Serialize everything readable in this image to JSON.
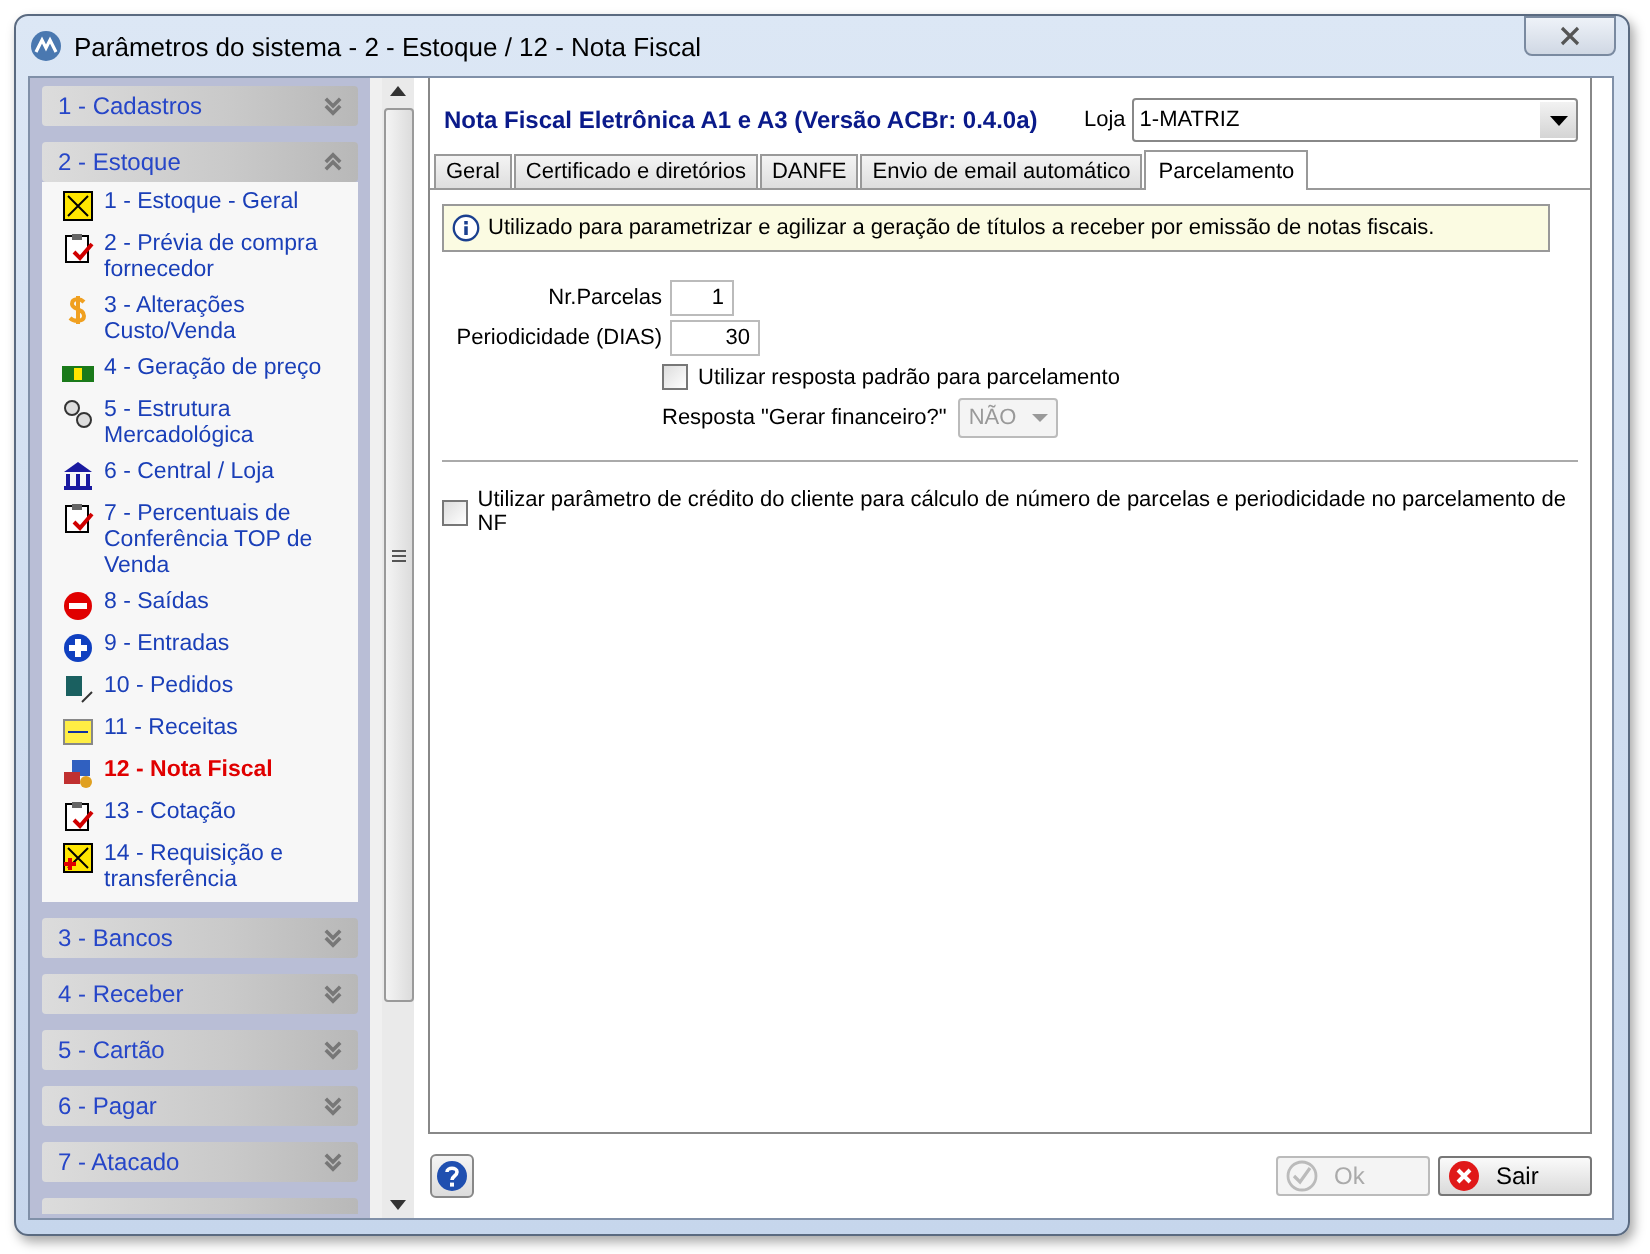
{
  "window": {
    "title": "Parâmetros do sistema - 2 - Estoque / 12 - Nota Fiscal"
  },
  "sidebar": {
    "groups": [
      {
        "label": "1 - Cadastros",
        "expanded": false
      },
      {
        "label": "2 - Estoque",
        "expanded": true,
        "items": [
          {
            "label": "1 - Estoque - Geral",
            "selected": false
          },
          {
            "label": "2 - Prévia de compra fornecedor",
            "selected": false
          },
          {
            "label": "3 - Alterações Custo/Venda",
            "selected": false
          },
          {
            "label": "4 - Geração de preço",
            "selected": false
          },
          {
            "label": "5 - Estrutura Mercadológica",
            "selected": false
          },
          {
            "label": "6 - Central / Loja",
            "selected": false
          },
          {
            "label": "7 - Percentuais de Conferência TOP de Venda",
            "selected": false
          },
          {
            "label": "8 - Saídas",
            "selected": false
          },
          {
            "label": "9 - Entradas",
            "selected": false
          },
          {
            "label": "10 - Pedidos",
            "selected": false
          },
          {
            "label": "11 - Receitas",
            "selected": false
          },
          {
            "label": "12 - Nota Fiscal",
            "selected": true
          },
          {
            "label": "13 - Cotação",
            "selected": false
          },
          {
            "label": "14 - Requisição e transferência",
            "selected": false
          }
        ]
      },
      {
        "label": "3 - Bancos",
        "expanded": false
      },
      {
        "label": "4 - Receber",
        "expanded": false
      },
      {
        "label": "5 - Cartão",
        "expanded": false
      },
      {
        "label": "6 - Pagar",
        "expanded": false
      },
      {
        "label": "7 - Atacado",
        "expanded": false
      }
    ]
  },
  "panel": {
    "title": "Nota Fiscal Eletrônica A1 e A3 (Versão ACBr: 0.4.0a)",
    "store_label": "Loja",
    "store_value": "1-MATRIZ",
    "tabs": [
      {
        "label": "Geral",
        "selected": false
      },
      {
        "label": "Certificado e diretórios",
        "selected": false
      },
      {
        "label": "DANFE",
        "selected": false
      },
      {
        "label": "Envio de email automático",
        "selected": false
      },
      {
        "label": "Parcelamento",
        "selected": true
      }
    ],
    "info": "Utilizado para parametrizar e agilizar a geração de títulos a receber por emissão de notas fiscais.",
    "fields": [
      {
        "label": "Nr.Parcelas",
        "value": "1"
      },
      {
        "label": "Periodicidade (DIAS)",
        "value": "30"
      }
    ],
    "default_answer": {
      "label": "Utilizar resposta padrão para parcelamento",
      "checked": false
    },
    "answer_select": {
      "label": "Resposta \"Gerar financeiro?\"",
      "value": "NÃO",
      "disabled": true
    },
    "credit_option": {
      "label": "Utilizar parâmetro de crédito do cliente para cálculo de número de parcelas e periodicidade no parcelamento de NF",
      "checked": false
    }
  },
  "buttons": [
    {
      "kind": "ok",
      "label": "Ok",
      "disabled": true
    },
    {
      "kind": "exit",
      "label": "Sair",
      "disabled": false
    }
  ]
}
